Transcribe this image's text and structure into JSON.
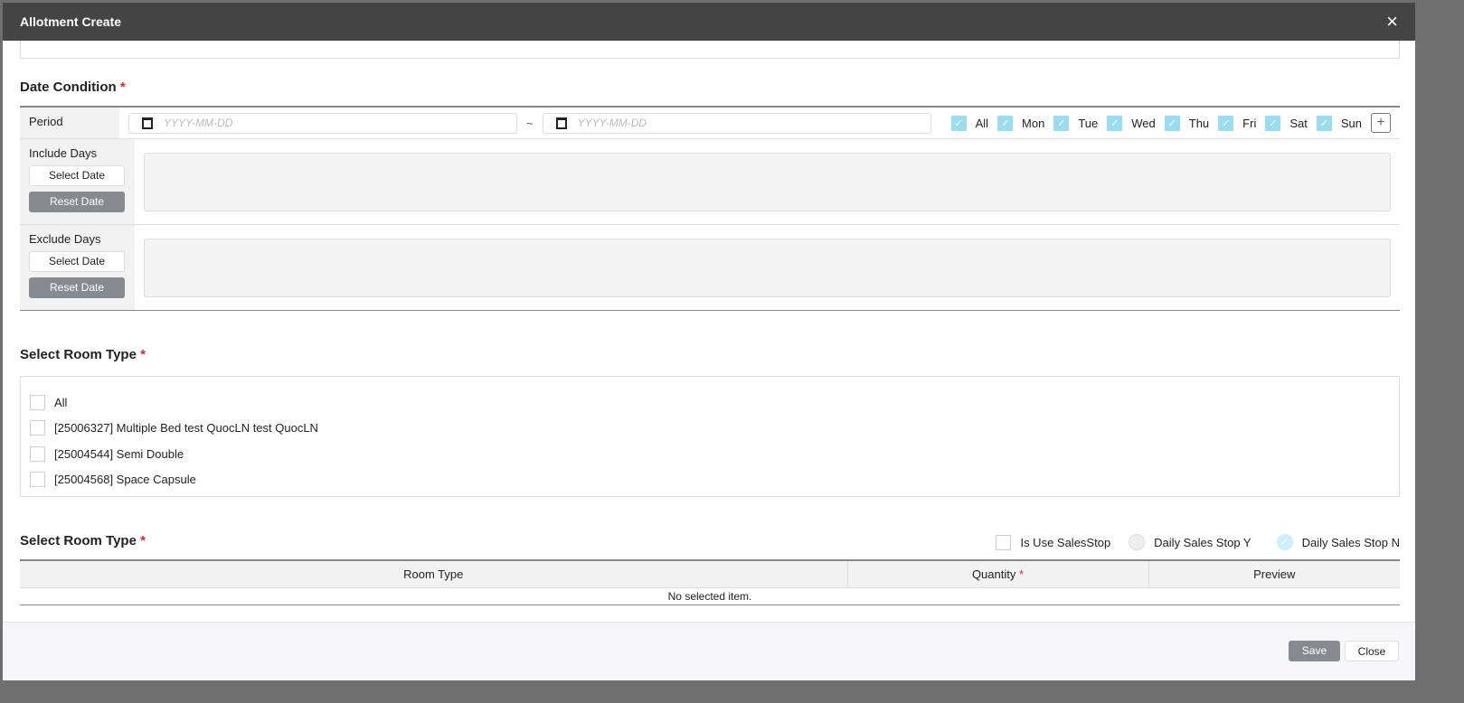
{
  "modal": {
    "title": "Allotment Create",
    "close_icon": "×"
  },
  "date_condition": {
    "title": "Date Condition",
    "required": "*",
    "period_label": "Period",
    "date_placeholder": "YYYY-MM-DD",
    "separator": "~",
    "days": [
      {
        "label": "All",
        "checked": true
      },
      {
        "label": "Mon",
        "checked": true
      },
      {
        "label": "Tue",
        "checked": true
      },
      {
        "label": "Wed",
        "checked": true
      },
      {
        "label": "Thu",
        "checked": true
      },
      {
        "label": "Fri",
        "checked": true
      },
      {
        "label": "Sat",
        "checked": true
      },
      {
        "label": "Sun",
        "checked": true
      }
    ],
    "add_label": "+",
    "include_label": "Include Days",
    "exclude_label": "Exclude Days",
    "select_date": "Select Date",
    "reset_date": "Reset Date"
  },
  "room_select": {
    "title": "Select Room Type",
    "required": "*",
    "items": [
      "All",
      "[25006327] Multiple Bed test QuocLN test QuocLN",
      "[25004544] Semi Double",
      "[25004568] Space Capsule"
    ]
  },
  "room_table": {
    "title": "Select Room Type",
    "required": "*",
    "is_use_salesstop": "Is Use SalesStop",
    "daily_y": "Daily Sales Stop Y",
    "daily_n": "Daily Sales Stop N",
    "headers": {
      "room_type": "Room Type",
      "quantity": "Quantity",
      "preview": "Preview"
    },
    "empty": "No selected item."
  },
  "footer": {
    "save": "Save",
    "close": "Close"
  }
}
